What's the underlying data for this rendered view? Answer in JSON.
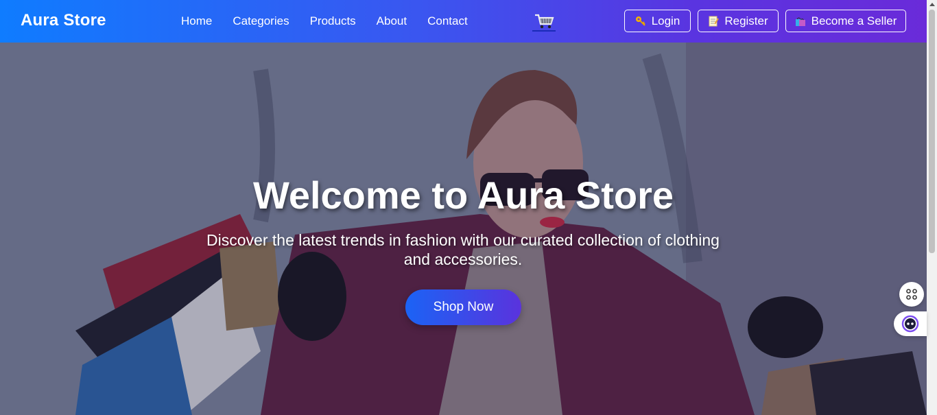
{
  "header": {
    "logo": "Aura Store",
    "nav": [
      "Home",
      "Categories",
      "Products",
      "About",
      "Contact"
    ],
    "buttons": {
      "login": "Login",
      "register": "Register",
      "seller": "Become a Seller"
    },
    "icons": [
      "shopping-cart-icon",
      "key-icon",
      "memo-icon",
      "shopping-bags-icon"
    ]
  },
  "hero": {
    "title": "Welcome to Aura Store",
    "subtitle": "Discover the latest trends in fashion with our curated collection of clothing and accessories.",
    "cta": "Shop Now"
  },
  "colors": {
    "header_start": "#0f7cff",
    "header_end": "#6a2bd9",
    "cta_start": "#1b63f5",
    "cta_end": "#5a33dd"
  }
}
